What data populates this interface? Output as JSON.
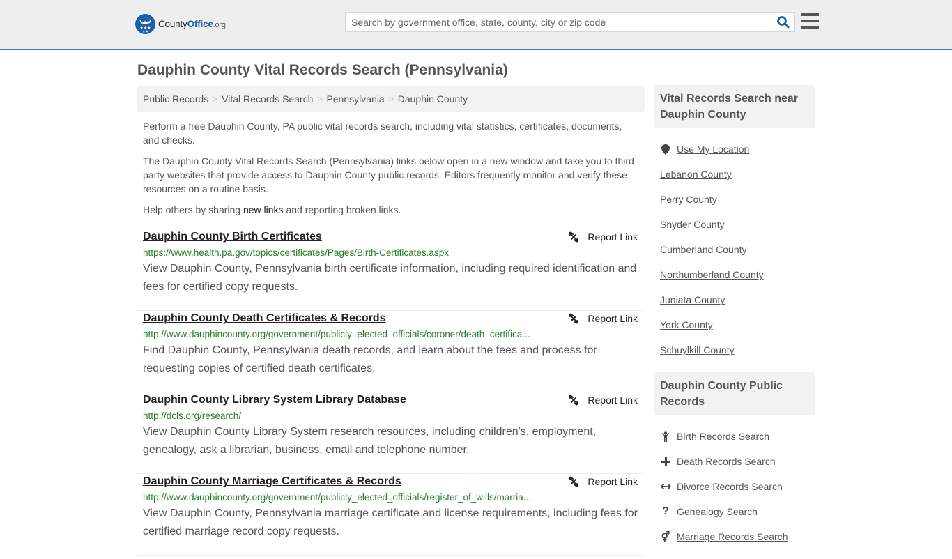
{
  "header": {
    "logo": {
      "name": "County",
      "highlight": "Office",
      "tld": ".org"
    },
    "search": {
      "placeholder": "Search by government office, state, county, city or zip code",
      "value": ""
    },
    "colors": {
      "accent": "#3a7cba",
      "brand": "#1f5fa8"
    }
  },
  "page": {
    "title": "Dauphin County Vital Records Search (Pennsylvania)"
  },
  "breadcrumb": [
    {
      "label": "Public Records"
    },
    {
      "label": "Vital Records Search"
    },
    {
      "label": "Pennsylvania"
    },
    {
      "label": "Dauphin County"
    }
  ],
  "breadcrumb_separator": ">",
  "intro": {
    "p1": "Perform a free Dauphin County, PA public vital records search, including vital statistics, certificates, documents, and checks.",
    "p2": "The Dauphin County Vital Records Search (Pennsylvania) links below open in a new window and take you to third party websites that provide access to Dauphin County public records. Editors frequently monitor and verify these resources on a routine basis.",
    "p3_before": "Help others by sharing ",
    "p3_link": "new links",
    "p3_after": " and reporting broken links."
  },
  "report_label": "Report Link",
  "results": [
    {
      "title": "Dauphin County Birth Certificates",
      "url": "https://www.health.pa.gov/topics/certificates/Pages/Birth-Certificates.aspx",
      "description": "View Dauphin County, Pennsylvania birth certificate information, including required identification and fees for certified copy requests."
    },
    {
      "title": "Dauphin County Death Certificates & Records",
      "url": "http://www.dauphincounty.org/government/publicly_elected_officials/coroner/death_certifica...",
      "description": "Find Dauphin County, Pennsylvania death records, and learn about the fees and process for requesting copies of certified death certificates."
    },
    {
      "title": "Dauphin County Library System Library Database",
      "url": "http://dcls.org/research/",
      "description": "View Dauphin County Library System research resources, including children's, employment, genealogy, ask a librarian, business, email and telephone number."
    },
    {
      "title": "Dauphin County Marriage Certificates & Records",
      "url": "http://www.dauphincounty.org/government/publicly_elected_officials/register_of_wills/marria...",
      "description": "View Dauphin County, Pennsylvania marriage certificate and license requirements, including fees for certified marriage record copy requests."
    }
  ],
  "sidebar": {
    "nearby": {
      "heading": "Vital Records Search near Dauphin County",
      "use_location": "Use My Location",
      "counties": [
        "Lebanon County",
        "Perry County",
        "Snyder County",
        "Cumberland County",
        "Northumberland County",
        "Juniata County",
        "York County",
        "Schuylkill County"
      ]
    },
    "public_records": {
      "heading": "Dauphin County Public Records",
      "items": [
        {
          "label": "Birth Records Search",
          "icon": "child-icon"
        },
        {
          "label": "Death Records Search",
          "icon": "plus-icon"
        },
        {
          "label": "Divorce Records Search",
          "icon": "arrows-horizontal-icon"
        },
        {
          "label": "Genealogy Search",
          "icon": "question-icon"
        },
        {
          "label": "Marriage Records Search",
          "icon": "gender-icon"
        }
      ]
    }
  }
}
